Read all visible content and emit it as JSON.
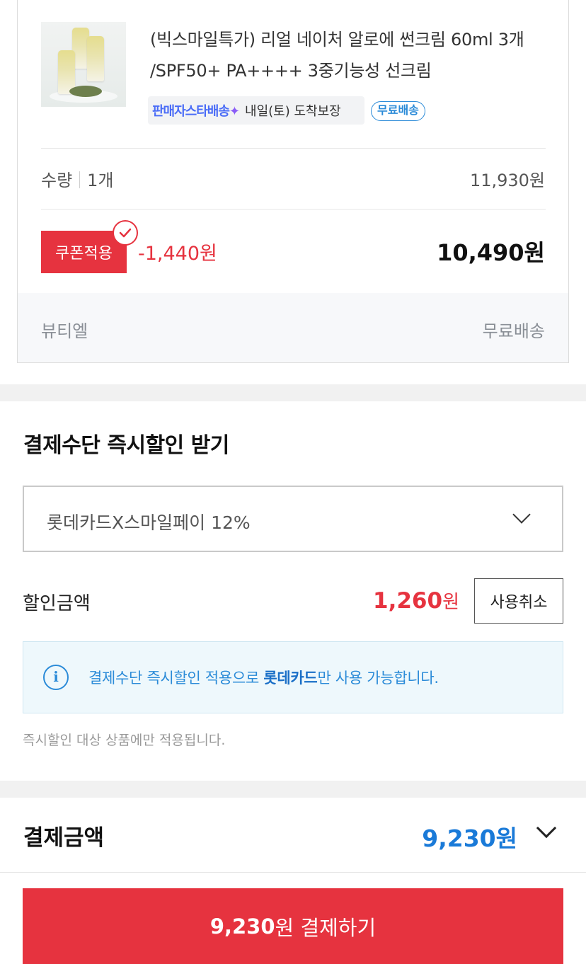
{
  "product": {
    "name": "(빅스마일특가) 리얼 네이처 알로에 썬크림 60ml 3개 /SPF50+ PA++++ 3중기능성 선크림",
    "delivery_logo": "판매자스타배송",
    "delivery_text": "내일(토) 도착보장",
    "free_shipping_badge": "무료배송",
    "quantity_label": "수량",
    "quantity_value": "1개",
    "unit_price": "11,930원",
    "coupon_button": "쿠폰적용",
    "coupon_discount": "-1,440원",
    "final_price": "10,490원",
    "seller": "뷰티엘",
    "shipping": "무료배송"
  },
  "payment_discount": {
    "title": "결제수단 즉시할인 받기",
    "selected_option": "롯데카드X스마일페이 12%",
    "discount_label": "할인금액",
    "discount_amount": "1,260",
    "discount_unit": "원",
    "cancel_button": "사용취소",
    "info_prefix": "결제수단 즉시할인 적용으로 ",
    "info_card": "롯데카드",
    "info_suffix": "만 사용 가능합니다.",
    "fine_print": "즉시할인 대상 상품에만 적용됩니다."
  },
  "total": {
    "label": "결제금액",
    "amount": "9,230원"
  },
  "pay_button": {
    "amount": "9,230",
    "label": "원 결제하기"
  },
  "colors": {
    "accent_red": "#e6333f",
    "accent_blue": "#1a7ad8",
    "info_bg": "#eef8fc"
  }
}
